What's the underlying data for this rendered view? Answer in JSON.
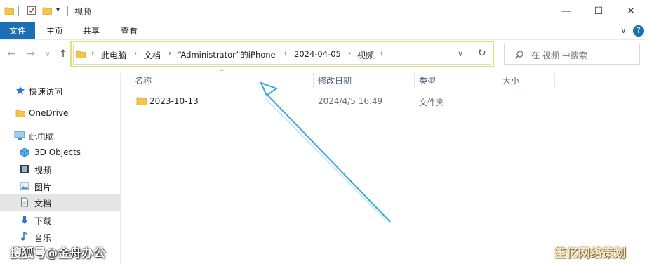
{
  "window": {
    "title": "视频",
    "minimize_glyph": "—",
    "maximize_glyph": "☐",
    "close_glyph": "✕"
  },
  "ribbon": {
    "tabs": [
      "文件",
      "主页",
      "共享",
      "查看"
    ],
    "collapse_glyph": "∨",
    "help_glyph": "?"
  },
  "navigation": {
    "back_glyph": "←",
    "forward_glyph": "→",
    "recent_glyph": "∨",
    "up_glyph": "↑"
  },
  "address_bar": {
    "breadcrumbs": [
      "此电脑",
      "文档",
      "“Administrator”的iPhone",
      "2024-04-05",
      "视频"
    ],
    "separator": "›",
    "dropdown_glyph": "∨",
    "refresh_glyph": "↻"
  },
  "search": {
    "placeholder": "在 视频 中搜索"
  },
  "sidebar": {
    "items": [
      {
        "label": "快速访问",
        "icon": "star-icon"
      },
      {
        "label": "OneDrive",
        "icon": "folder-icon"
      },
      {
        "label": "此电脑",
        "icon": "computer-icon"
      },
      {
        "label": "3D Objects",
        "icon": "cube-icon"
      },
      {
        "label": "视频",
        "icon": "video-icon"
      },
      {
        "label": "图片",
        "icon": "picture-icon"
      },
      {
        "label": "文档",
        "icon": "document-icon"
      },
      {
        "label": "下载",
        "icon": "download-icon"
      },
      {
        "label": "音乐",
        "icon": "music-icon"
      }
    ]
  },
  "file_list": {
    "columns": [
      "名称",
      "修改日期",
      "类型",
      "大小"
    ],
    "rows": [
      {
        "name": "2023-10-13",
        "modified": "2024/4/5 16:49",
        "type": "文件夹",
        "size": ""
      }
    ]
  },
  "watermarks": {
    "left": "搜狐号@金舟办公",
    "right": "笙亿网络策划"
  },
  "colors": {
    "accent": "#1a6fb5",
    "highlight_border": "#e7e16a",
    "arrow": "#3aa7d8",
    "folder": "#f4c548"
  }
}
